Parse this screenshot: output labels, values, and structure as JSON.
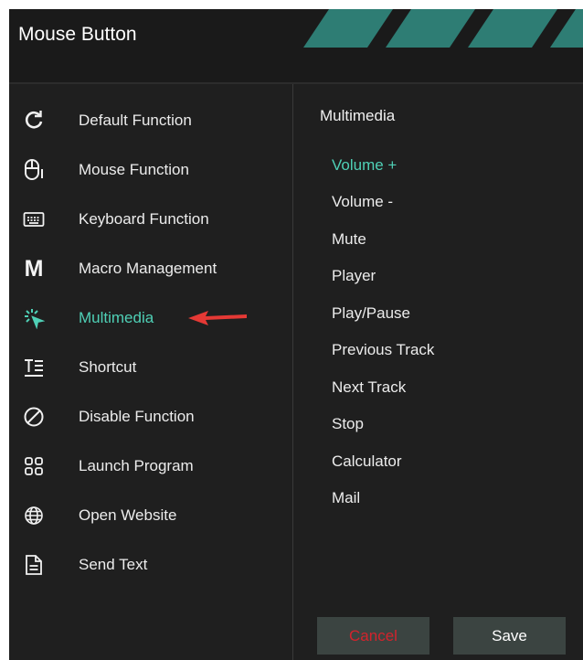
{
  "window": {
    "title": "Mouse Button"
  },
  "menu": {
    "items": [
      {
        "icon": "refresh-icon",
        "label": "Default Function"
      },
      {
        "icon": "mouse-icon",
        "label": "Mouse Function"
      },
      {
        "icon": "keyboard-icon",
        "label": "Keyboard Function"
      },
      {
        "icon": "macro-m-icon",
        "label": "Macro Management"
      },
      {
        "icon": "multimedia-cursor-icon",
        "label": "Multimedia"
      },
      {
        "icon": "shortcut-icon",
        "label": "Shortcut"
      },
      {
        "icon": "disable-icon",
        "label": "Disable Function"
      },
      {
        "icon": "apps-grid-icon",
        "label": "Launch Program"
      },
      {
        "icon": "globe-icon",
        "label": "Open Website"
      },
      {
        "icon": "document-icon",
        "label": "Send Text"
      }
    ],
    "active_index": 4
  },
  "multimedia_panel": {
    "header": "Multimedia",
    "options": [
      "Volume +",
      "Volume -",
      "Mute",
      "Player",
      "Play/Pause",
      "Previous Track",
      "Next Track",
      "Stop",
      "Calculator",
      "Mail"
    ],
    "selected_index": 0
  },
  "buttons": {
    "cancel": "Cancel",
    "save": "Save"
  },
  "colors": {
    "background": "#1f1f1f",
    "accent": "#4fd0b6",
    "stripe": "#2e7d74",
    "cancel_text": "#d3232c",
    "button_bg": "#3b4441",
    "annotation_arrow": "#e53935"
  }
}
